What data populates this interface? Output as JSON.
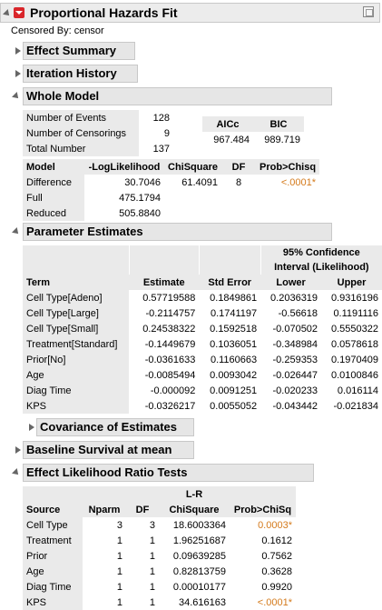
{
  "title": "Proportional Hazards Fit",
  "censored_by": "Censored By: censor",
  "sections": {
    "effect_summary": "Effect Summary",
    "iteration_history": "Iteration History",
    "whole_model": "Whole Model",
    "parameter_estimates": "Parameter Estimates",
    "covariance": "Covariance of Estimates",
    "baseline": "Baseline Survival at mean",
    "lr_tests": "Effect Likelihood Ratio Tests"
  },
  "whole_model": {
    "counts": [
      {
        "label": "Number of Events",
        "value": "128"
      },
      {
        "label": "Number of Censorings",
        "value": "9"
      },
      {
        "label": "Total Number",
        "value": "137"
      }
    ],
    "ic_headers": [
      "AICc",
      "BIC"
    ],
    "ic_values": [
      "967.484",
      "989.719"
    ],
    "headers": [
      "Model",
      "-LogLikelihood",
      "ChiSquare",
      "DF",
      "Prob>Chisq"
    ],
    "rows": [
      {
        "model": "Difference",
        "loglik": "30.7046",
        "chisq": "61.4091",
        "df": "8",
        "p": "<.0001*"
      },
      {
        "model": "Full",
        "loglik": "475.1794",
        "chisq": "",
        "df": "",
        "p": ""
      },
      {
        "model": "Reduced",
        "loglik": "505.8840",
        "chisq": "",
        "df": "",
        "p": ""
      }
    ]
  },
  "param": {
    "ci_header1": "95% Confidence",
    "ci_header2": "Interval (Likelihood)",
    "headers": [
      "Term",
      "Estimate",
      "Std Error",
      "Lower",
      "Upper"
    ],
    "rows": [
      [
        "Cell Type[Adeno]",
        "0.57719588",
        "0.1849861",
        "0.2036319",
        "0.9316196"
      ],
      [
        "Cell Type[Large]",
        "-0.2114757",
        "0.1741197",
        "-0.56618",
        "0.1191116"
      ],
      [
        "Cell Type[Small]",
        "0.24538322",
        "0.1592518",
        "-0.070502",
        "0.5550322"
      ],
      [
        "Treatment[Standard]",
        "-0.1449679",
        "0.1036051",
        "-0.348984",
        "0.0578618"
      ],
      [
        "Prior[No]",
        "-0.0361633",
        "0.1160663",
        "-0.259353",
        "0.1970409"
      ],
      [
        "Age",
        "-0.0085494",
        "0.0093042",
        "-0.026447",
        "0.0100846"
      ],
      [
        "Diag Time",
        "-0.000092",
        "0.0091251",
        "-0.020233",
        "0.016114"
      ],
      [
        "KPS",
        "-0.0326217",
        "0.0055052",
        "-0.043442",
        "-0.021834"
      ]
    ]
  },
  "lr": {
    "lr_header": "L-R",
    "headers": [
      "Source",
      "Nparm",
      "DF",
      "ChiSquare",
      "Prob>ChiSq"
    ],
    "rows": [
      [
        "Cell Type",
        "3",
        "3",
        "18.6003364",
        "0.0003*"
      ],
      [
        "Treatment",
        "1",
        "1",
        "1.96251687",
        "0.1612"
      ],
      [
        "Prior",
        "1",
        "1",
        "0.09639285",
        "0.7562"
      ],
      [
        "Age",
        "1",
        "1",
        "0.82813759",
        "0.3628"
      ],
      [
        "Diag Time",
        "1",
        "1",
        "0.00010177",
        "0.9920"
      ],
      [
        "KPS",
        "1",
        "1",
        "34.616163",
        "<.0001*"
      ]
    ]
  },
  "colors": {
    "significant": "#d47a1b",
    "menu_red": "#d9262b"
  }
}
